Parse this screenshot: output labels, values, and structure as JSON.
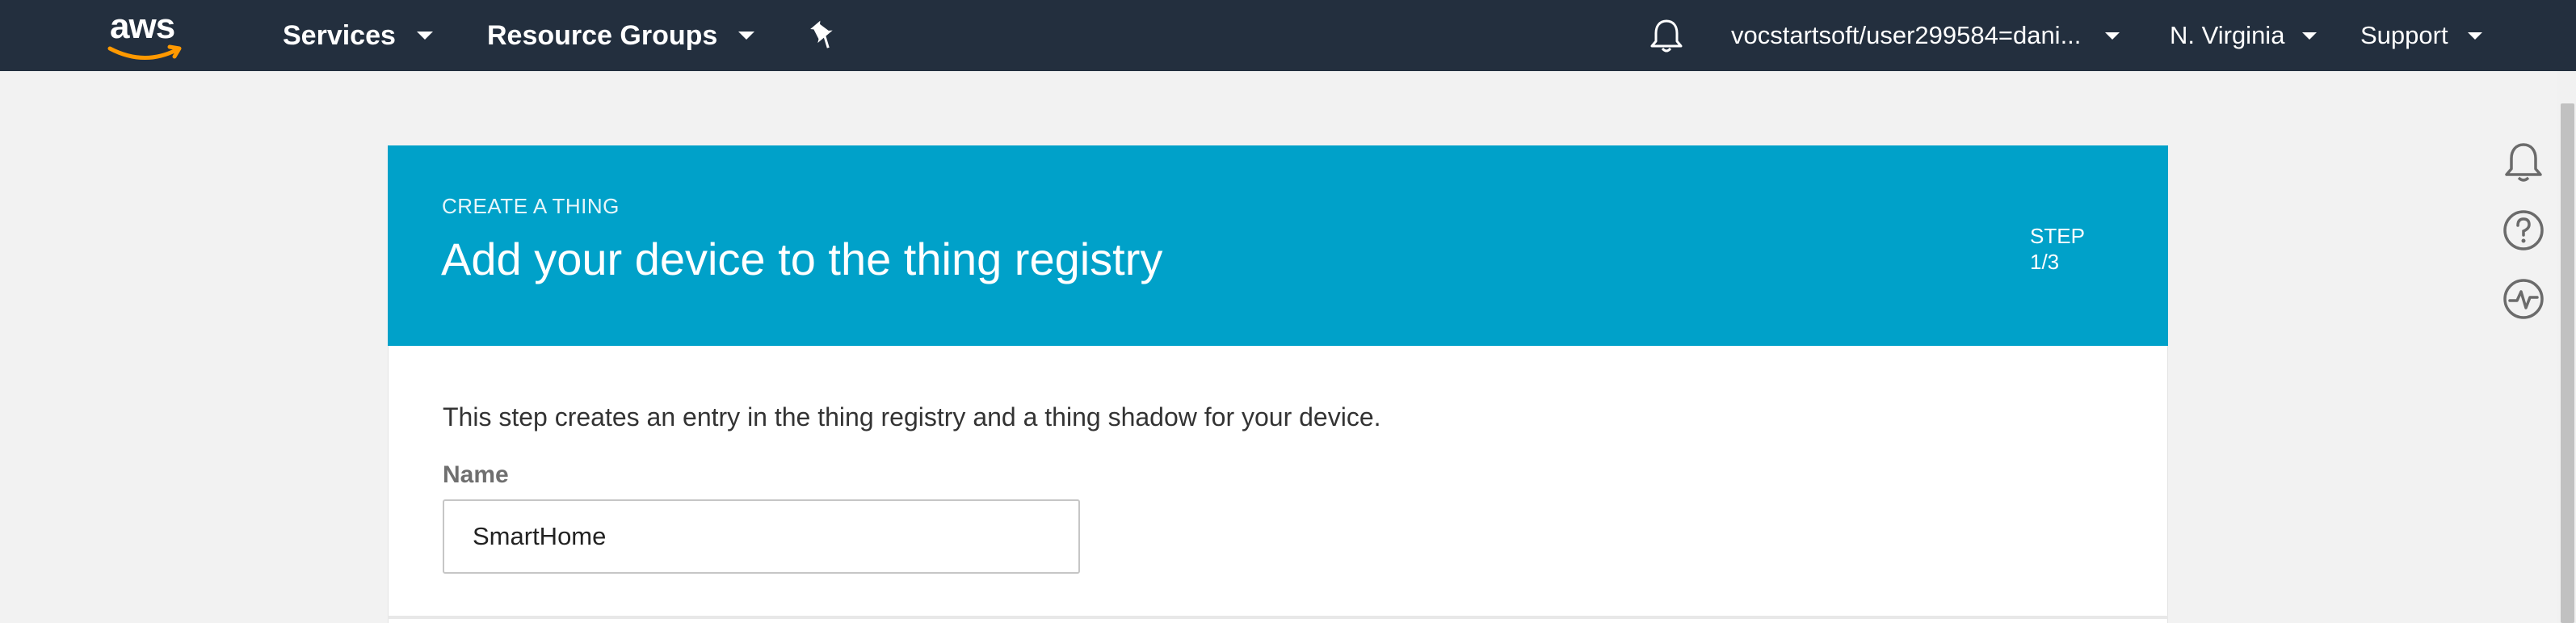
{
  "topnav": {
    "logo_text": "aws",
    "services_label": "Services",
    "resource_groups_label": "Resource Groups",
    "account_label": "vocstartsoft/user299584=dani...",
    "region_label": "N. Virginia",
    "support_label": "Support"
  },
  "card": {
    "eyebrow": "CREATE A THING",
    "title": "Add your device to the thing registry",
    "step_label": "STEP",
    "step_value": "1/3",
    "description": "This step creates an entry in the thing registry and a thing shadow for your device.",
    "name_label": "Name",
    "name_value": "SmartHome"
  },
  "colors": {
    "nav_bg": "#232f3e",
    "header_bg": "#00a1c9",
    "page_bg": "#f2f2f2",
    "aws_smile": "#ff9900"
  },
  "icons": [
    "chevron-down-icon",
    "pin-icon",
    "bell-icon",
    "help-icon",
    "health-icon"
  ]
}
